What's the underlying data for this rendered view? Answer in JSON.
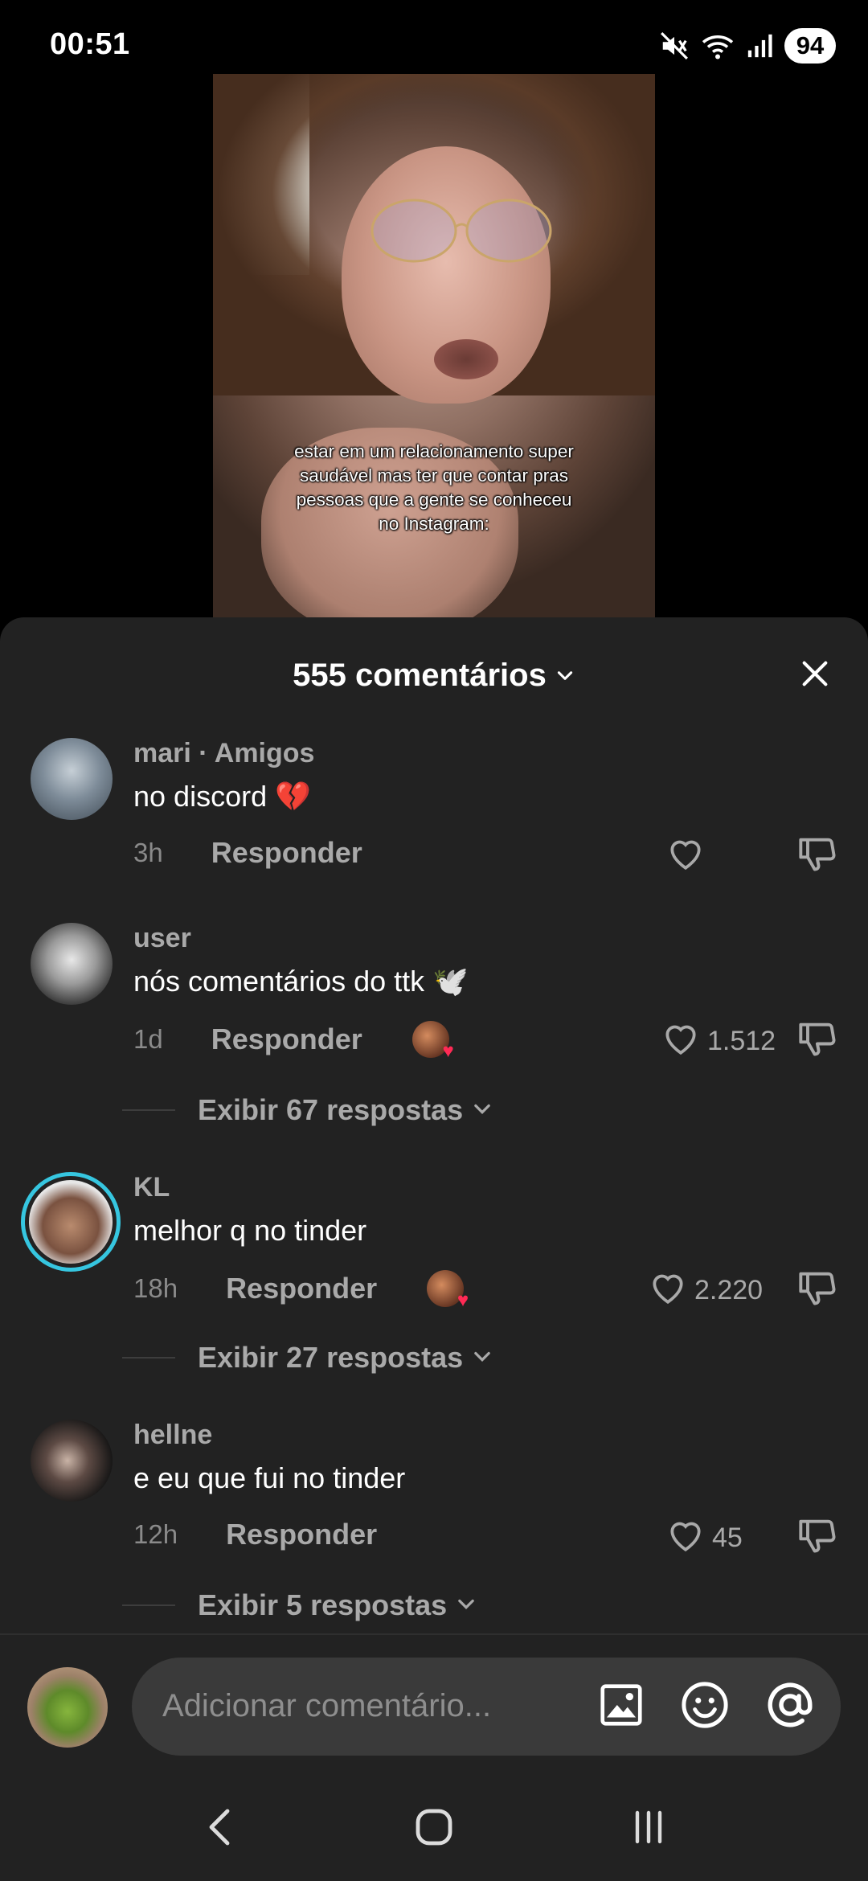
{
  "status": {
    "time": "00:51",
    "battery": "94",
    "icons": [
      "mute-icon",
      "wifi-icon",
      "signal-icon"
    ]
  },
  "video": {
    "caption": "estar em um relacionamento super saudável mas ter que contar pras pessoas que a gente se conheceu no Instagram:"
  },
  "comments_header": {
    "title": "555 comentários"
  },
  "comments": [
    {
      "name": "mari · Amigos",
      "text": "no discord 💔",
      "time": "3h",
      "reply_label": "Responder",
      "likes": "",
      "replies": ""
    },
    {
      "name": "user",
      "text": "nós comentários do ttk 🕊️",
      "time": "1d",
      "reply_label": "Responder",
      "likes": "1.512",
      "replies": "Exibir 67 respostas"
    },
    {
      "name": "KL",
      "text": "melhor q no tinder",
      "time": "18h",
      "reply_label": "Responder",
      "likes": "2.220",
      "replies": "Exibir 27 respostas"
    },
    {
      "name": "hellne",
      "text": "e eu que fui no tinder",
      "time": "12h",
      "reply_label": "Responder",
      "likes": "45",
      "replies": "Exibir 5 respostas"
    }
  ],
  "input": {
    "placeholder": "Adicionar comentário..."
  },
  "colors": {
    "sheet_bg": "#222222",
    "accent_heart": "#ff2a55"
  }
}
